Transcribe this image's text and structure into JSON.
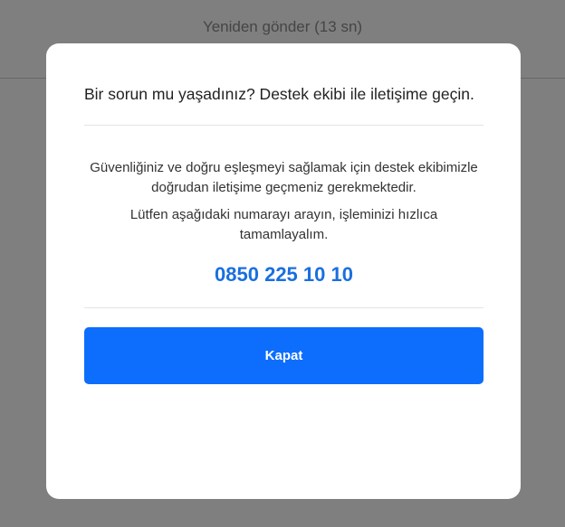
{
  "background": {
    "resend_label": "Yeniden gönder (13 sn)"
  },
  "modal": {
    "title": "Bir sorun mu yaşadınız? Destek ekibi ile iletişime geçin.",
    "paragraph_1": "Güvenliğiniz ve doğru eşleşmeyi sağlamak için destek ekibimizle doğrudan iletişime geçmeniz gerekmektedir.",
    "paragraph_2": "Lütfen aşağıdaki numarayı arayın, işleminizi hızlıca tamamlayalım.",
    "phone_number": "0850 225 10 10",
    "close_label": "Kapat"
  },
  "colors": {
    "accent": "#0d6efd",
    "phone": "#1a6fe0",
    "overlay": "rgba(0,0,0,0.5)"
  }
}
